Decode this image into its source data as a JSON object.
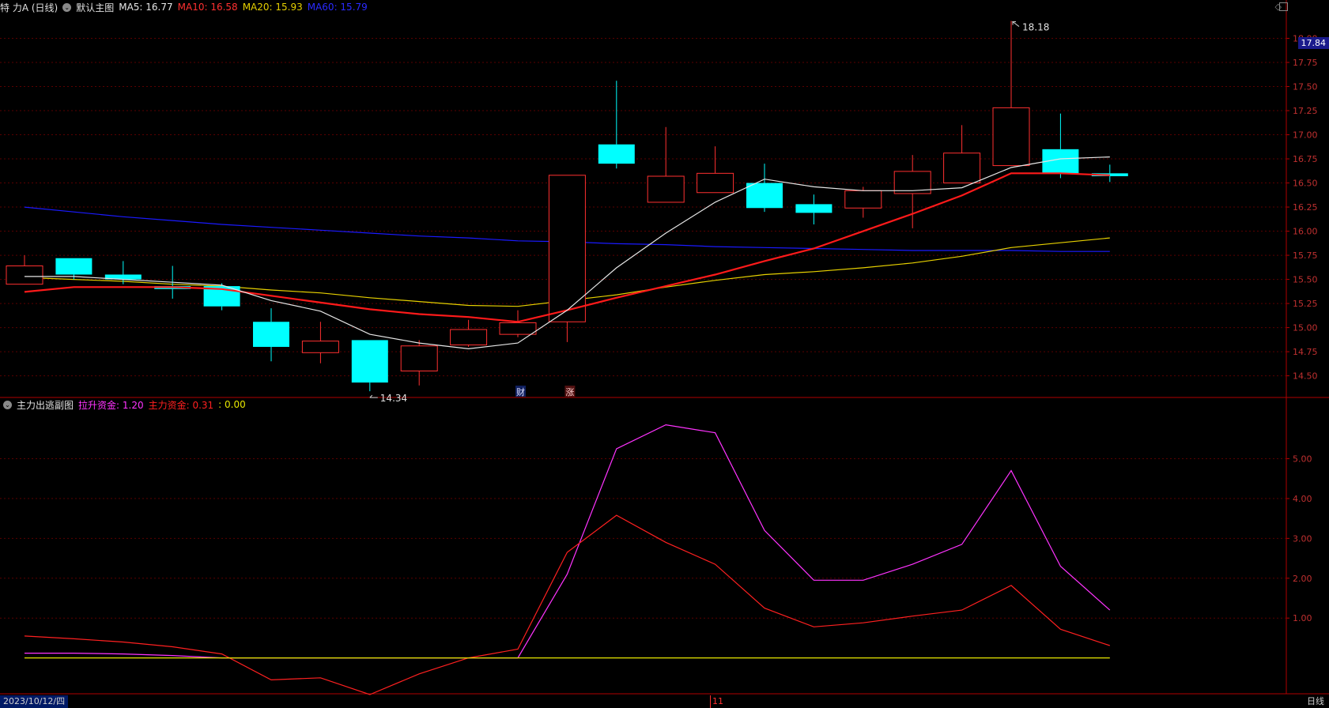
{
  "main_header": {
    "title": "特 力A (日线)",
    "template": "默认主图",
    "ma5": "MA5: 16.77",
    "ma10": "MA10: 16.58",
    "ma20": "MA20: 15.93",
    "ma60": "MA60: 15.79"
  },
  "sub_header": {
    "title": "主力出逃副图",
    "s1": "拉升资金: 1.20",
    "s2": "主力资金: 0.31",
    "s3": ": 0.00"
  },
  "current_price": "17.84",
  "high_label": "18.18",
  "low_label": "14.34",
  "marker_cai": "财",
  "marker_zhang": "涨",
  "status": {
    "date": "2023/10/12/四",
    "mid": "11",
    "period": "日线"
  },
  "colors": {
    "up": "#ff3030",
    "down": "#00ffff",
    "ma5": "#e6e6e6",
    "ma10": "#ff1a1a",
    "ma20": "#e6d000",
    "ma60": "#1a1aff",
    "lashen": "#ff33ff",
    "zhuli": "#ff2020",
    "zero": "#e6e600"
  },
  "chart_data": [
    {
      "type": "candlestick",
      "ylim": [
        14.3,
        18.25
      ],
      "y_ticks": [
        "18.00",
        "17.75",
        "17.50",
        "17.25",
        "17.00",
        "16.75",
        "16.50",
        "16.25",
        "16.00",
        "15.75",
        "15.50",
        "15.25",
        "15.00",
        "14.75",
        "14.50"
      ],
      "candles": [
        {
          "o": 15.45,
          "c": 15.64,
          "h": 15.75,
          "l": 15.45
        },
        {
          "o": 15.72,
          "c": 15.55,
          "h": 15.72,
          "l": 15.5
        },
        {
          "o": 15.55,
          "c": 15.5,
          "h": 15.69,
          "l": 15.45
        },
        {
          "o": 15.43,
          "c": 15.4,
          "h": 15.64,
          "l": 15.3
        },
        {
          "o": 15.43,
          "c": 15.22,
          "h": 15.46,
          "l": 15.18
        },
        {
          "o": 15.06,
          "c": 14.8,
          "h": 15.2,
          "l": 14.65
        },
        {
          "o": 14.74,
          "c": 14.86,
          "h": 15.06,
          "l": 14.63
        },
        {
          "o": 14.87,
          "c": 14.43,
          "h": 14.87,
          "l": 14.34
        },
        {
          "o": 14.55,
          "c": 14.81,
          "h": 14.87,
          "l": 14.4
        },
        {
          "o": 14.82,
          "c": 14.98,
          "h": 15.08,
          "l": 14.8
        },
        {
          "o": 14.93,
          "c": 15.05,
          "h": 15.18,
          "l": 14.9
        },
        {
          "o": 15.06,
          "c": 16.58,
          "h": 16.58,
          "l": 14.85
        },
        {
          "o": 16.9,
          "c": 16.7,
          "h": 17.56,
          "l": 16.65
        },
        {
          "o": 16.3,
          "c": 16.57,
          "h": 17.08,
          "l": 16.3
        },
        {
          "o": 16.4,
          "c": 16.6,
          "h": 16.88,
          "l": 16.4
        },
        {
          "o": 16.5,
          "c": 16.24,
          "h": 16.7,
          "l": 16.2
        },
        {
          "o": 16.28,
          "c": 16.19,
          "h": 16.38,
          "l": 16.07
        },
        {
          "o": 16.24,
          "c": 16.42,
          "h": 16.46,
          "l": 16.14
        },
        {
          "o": 16.39,
          "c": 16.62,
          "h": 16.79,
          "l": 16.03
        },
        {
          "o": 16.5,
          "c": 16.81,
          "h": 17.1,
          "l": 16.5
        },
        {
          "o": 16.68,
          "c": 17.28,
          "h": 18.18,
          "l": 16.68
        },
        {
          "o": 16.85,
          "c": 16.6,
          "h": 17.22,
          "l": 16.55
        },
        {
          "o": 16.6,
          "c": 16.57,
          "h": 16.69,
          "l": 16.51
        }
      ],
      "ma5": [
        15.53,
        15.53,
        15.5,
        15.47,
        15.44,
        15.28,
        15.17,
        14.93,
        14.84,
        14.78,
        14.84,
        15.18,
        15.62,
        15.98,
        16.3,
        16.54,
        16.46,
        16.42,
        16.42,
        16.45,
        16.66,
        16.75,
        16.77
      ],
      "ma10": [
        15.37,
        15.42,
        15.42,
        15.42,
        15.4,
        15.33,
        15.26,
        15.19,
        15.14,
        15.11,
        15.06,
        15.18,
        15.31,
        15.43,
        15.55,
        15.69,
        15.82,
        16.0,
        16.18,
        16.37,
        16.6,
        16.6,
        16.58
      ],
      "ma20": [
        15.52,
        15.5,
        15.48,
        15.45,
        15.43,
        15.39,
        15.36,
        15.31,
        15.27,
        15.23,
        15.22,
        15.28,
        15.34,
        15.42,
        15.49,
        15.55,
        15.58,
        15.62,
        15.67,
        15.74,
        15.83,
        15.88,
        15.93
      ],
      "ma60": [
        16.25,
        16.2,
        16.15,
        16.11,
        16.07,
        16.04,
        16.01,
        15.98,
        15.95,
        15.93,
        15.9,
        15.89,
        15.87,
        15.86,
        15.84,
        15.83,
        15.82,
        15.81,
        15.8,
        15.8,
        15.8,
        15.79,
        15.79
      ]
    },
    {
      "type": "line",
      "ylim": [
        -0.9,
        6.2
      ],
      "y_ticks": [
        "5.00",
        "4.00",
        "3.00",
        "2.00",
        "1.00"
      ],
      "series": [
        {
          "name": "拉升资金",
          "values": [
            0.12,
            0.12,
            0.1,
            0.06,
            0,
            0,
            0,
            0,
            0,
            0,
            0,
            2.1,
            5.25,
            5.85,
            5.65,
            3.2,
            1.95,
            1.95,
            2.35,
            2.85,
            4.7,
            2.3,
            1.2
          ]
        },
        {
          "name": "主力资金",
          "values": [
            0.55,
            0.48,
            0.4,
            0.28,
            0.1,
            -0.55,
            -0.5,
            -0.92,
            -0.4,
            0,
            0.22,
            2.65,
            3.58,
            2.9,
            2.35,
            1.25,
            0.78,
            0.88,
            1.05,
            1.2,
            1.82,
            0.72,
            0.31
          ]
        },
        {
          "values": [
            0,
            0,
            0,
            0,
            0,
            0,
            0,
            0,
            0,
            0,
            0,
            0,
            0,
            0,
            0,
            0,
            0,
            0,
            0,
            0,
            0,
            0,
            0
          ]
        }
      ]
    }
  ]
}
